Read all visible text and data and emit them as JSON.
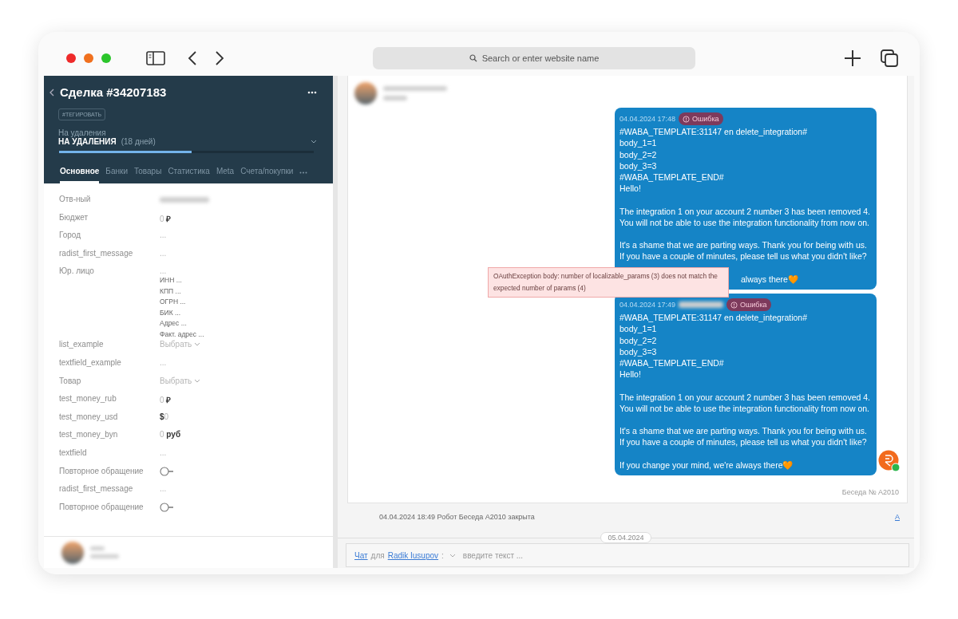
{
  "browser": {
    "address_placeholder": "Search or enter website name"
  },
  "deal": {
    "title": "Сделка #34207183",
    "tag_button": "#ТЕГИРОВАТЬ",
    "stage_caption": "На удаления",
    "stage": "НА УДАЛЕНИЯ",
    "stage_days": "(18 дней)",
    "level": 0.52,
    "tabs": [
      {
        "label": "Основное",
        "selected": true
      },
      {
        "label": "Банки",
        "selected": false
      },
      {
        "label": "Товары",
        "selected": false
      },
      {
        "label": "Статистика",
        "selected": false
      },
      {
        "label": "Meta",
        "selected": false
      },
      {
        "label": "Счета/покупки",
        "selected": false
      }
    ],
    "fields": [
      {
        "kind": "blurred",
        "label": "Отв-ный"
      },
      {
        "kind": "text",
        "label": "Бюджет",
        "value": "0 **₽**"
      },
      {
        "kind": "text",
        "label": "Город",
        "value": "..."
      },
      {
        "kind": "text",
        "label": "radist_first_message",
        "value": "..."
      },
      {
        "kind": "legal",
        "label": "Юр. лицо",
        "value": "...",
        "sub": [
          "ИНН ...",
          "КПП ...",
          "ОГРН ...",
          "БИК ...",
          "Адрес ...",
          "Факт. адрес ..."
        ]
      },
      {
        "kind": "select",
        "label": "list_example",
        "value": "Выбрать"
      },
      {
        "kind": "text",
        "label": "textfield_example",
        "value": "..."
      },
      {
        "kind": "select",
        "label": "Товар",
        "value": "Выбрать"
      },
      {
        "kind": "text",
        "label": "test_money_rub",
        "value": "0 **₽**"
      },
      {
        "kind": "text",
        "label": "test_money_usd",
        "value": "**$**0"
      },
      {
        "kind": "text",
        "label": "test_money_byn",
        "value": "0 **руб**"
      },
      {
        "kind": "text",
        "label": "textfield",
        "value": "..."
      },
      {
        "kind": "toggle",
        "label": "Повторное обращение",
        "on": false
      },
      {
        "kind": "text",
        "label": "radist_first_message",
        "value": "..."
      },
      {
        "kind": "toggle",
        "label": "Повторное обращение",
        "on": false
      }
    ]
  },
  "chat": {
    "messages": [
      {
        "time": "04.04.2024 17:48",
        "status": "Ошибка",
        "paragraphs": [
          [
            "#WABA_TEMPLATE:31147 en delete_integration#",
            "body_1=1",
            "body_2=2",
            "body_3=3",
            "#WABA_TEMPLATE_END#",
            "Hello!"
          ],
          [
            "The integration 1 on your account 2 number 3 has been removed 4.",
            "You will not be able to use the integration functionality from now on."
          ],
          [
            "It's a shame that we are parting ways. Thank you for being with us.",
            "If you have a couple of minutes, please tell us what you didn't like?"
          ]
        ],
        "covered_line": "always there🧡",
        "avatar": false
      },
      {
        "time": "04.04.2024 17:49",
        "status": "Ошибка",
        "paragraphs": [
          [
            "#WABA_TEMPLATE:31147 en delete_integration#",
            "body_1=1",
            "body_2=2",
            "body_3=3",
            "#WABA_TEMPLATE_END#",
            "Hello!"
          ],
          [
            "The integration 1 on your account 2 number 3 has been removed 4.",
            "You will not be able to use the integration functionality from now on."
          ],
          [
            "It's a shame that we are parting ways. Thank you for being with us.",
            "If you have a couple of minutes, please tell us what you didn't like?"
          ],
          [
            "If you change your mind, we're always there🧡"
          ]
        ],
        "avatar": true
      }
    ],
    "tooltip": "OAuthException body: number of localizable_params (3) does not match the expected number of params (4)",
    "conversation": "Беседа № A2010",
    "system_note": "04.04.2024 18:49 Робот Беседа A2010 закрыта",
    "system_link": "A",
    "date": "05.04.2024",
    "composer": {
      "channel": "Чат",
      "for": "для",
      "recipient": "Radik Iusupov",
      "colon": ":",
      "placeholder": "введите текст ..."
    }
  }
}
